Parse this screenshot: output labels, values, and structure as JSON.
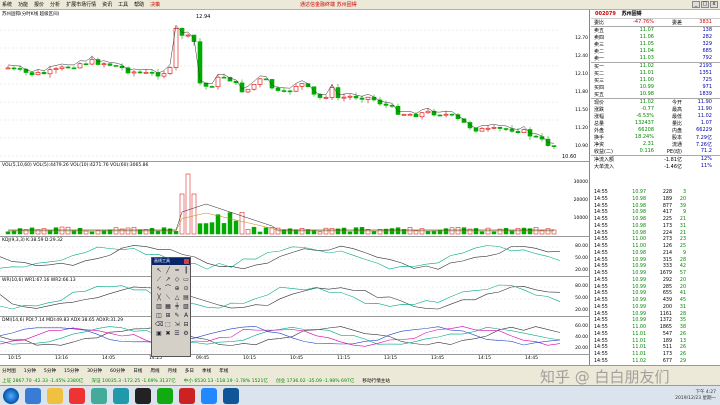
{
  "menu": {
    "items": [
      "系统",
      "功能",
      "报价",
      "分析",
      "扩展市场行情",
      "资讯",
      "工具",
      "帮助"
    ],
    "highlight": "决策",
    "center_title": "通达信金融终端 苏州固锝",
    "win_buttons": [
      "_",
      "□",
      "x"
    ]
  },
  "chart": {
    "price_header": "苏州固锝(分时K线 超级区间)",
    "high_label": "12.94",
    "low_label": "10.60",
    "price_axis": [
      "12.70",
      "12.40",
      "12.10",
      "11.80",
      "11.50",
      "11.20",
      "10.90"
    ],
    "volume_header": "VOL(5,10,60)  VOL(5):4479.26  VOL(10):4271.76  VOL(60):3065.86",
    "volume_axis": [
      "30000",
      "20000",
      "10000"
    ],
    "kdj_header": "KDJ(9,3,3)  K:38.59  D:29.32",
    "kdj_axis": [
      "80.00",
      "50.00",
      "20.00"
    ],
    "wr_header": "WR(10,6)  WR1:67.16  WR2:66.13",
    "wr_axis": [
      "80.00",
      "50.00",
      "20.00"
    ],
    "dmi_header": "DMI(14,6)  PDI:7.14  MDI:49.83  ADX:38.65  ADXR:31.29",
    "dmi_axis": [
      "60.00",
      "40.00",
      "20.00"
    ],
    "time_labels": [
      "10:15",
      "13:16",
      "14:05",
      "14:25",
      "09:45",
      "10:15",
      "10:45",
      "11:15",
      "13:15",
      "13:45",
      "14:15",
      "14:45"
    ]
  },
  "toolbox": {
    "title": "画线工具",
    "tools": [
      "↖",
      "╱",
      "━",
      "┃",
      "⟋",
      "↗",
      "◇",
      "▭",
      "∿",
      "⌒",
      "⊕",
      "⊙",
      "╳",
      "⟍",
      "△",
      "▤",
      "▥",
      "▦",
      "╪",
      "▧",
      "◫",
      "⊞",
      "✎",
      "A",
      "⌫",
      "⬚",
      "⇲",
      "⊟",
      "▣",
      "✖",
      "☰",
      "⚙"
    ]
  },
  "quote": {
    "code": "002079",
    "name": "苏州固锝",
    "header_rows": [
      {
        "a": "委比",
        "b": "-47.76%",
        "c": "委差",
        "d": "3831"
      }
    ],
    "sell_rows": [
      {
        "a": "卖五",
        "b": "11.07",
        "d": "138"
      },
      {
        "a": "卖四",
        "b": "11.06",
        "d": "282"
      },
      {
        "a": "卖三",
        "b": "11.05",
        "d": "329"
      },
      {
        "a": "卖二",
        "b": "11.04",
        "d": "685"
      },
      {
        "a": "卖一",
        "b": "11.03",
        "d": "792"
      }
    ],
    "buy_rows": [
      {
        "a": "买一",
        "b": "11.02",
        "d": "2193"
      },
      {
        "a": "买二",
        "b": "11.01",
        "d": "1351"
      },
      {
        "a": "买三",
        "b": "11.00",
        "d": "725"
      },
      {
        "a": "买四",
        "b": "10.99",
        "d": "971"
      },
      {
        "a": "买五",
        "b": "10.98",
        "d": "1839"
      }
    ],
    "stats_rows": [
      {
        "a": "现价",
        "b": "11.02",
        "c": "今开",
        "d": "11.90"
      },
      {
        "a": "涨跌",
        "b": "-0.77",
        "c": "最高",
        "d": "11.90"
      },
      {
        "a": "涨幅",
        "b": "-6.53%",
        "c": "最低",
        "d": "11.02"
      },
      {
        "a": "总量",
        "b": "132437",
        "c": "量比",
        "d": "1.07"
      },
      {
        "a": "外盘",
        "b": "66208",
        "c": "内盘",
        "d": "66229"
      },
      {
        "a": "换手",
        "b": "18.24%",
        "c": "股本",
        "d": "7.29亿"
      },
      {
        "a": "净资",
        "b": "2.31",
        "c": "流通",
        "d": "7.26亿"
      },
      {
        "a": "收益(二)",
        "b": "0.116",
        "c": "PE(动)",
        "d": "71.2"
      }
    ],
    "flow_rows": [
      {
        "a": "净流入额",
        "b": "",
        "c": "-1.81亿",
        "d": "12%"
      },
      {
        "a": "大单流入",
        "b": "",
        "c": "-1.46亿",
        "d": "11%"
      }
    ]
  },
  "ticks": [
    {
      "t": "14:55",
      "p": "10.97",
      "v": "228",
      "n": "3"
    },
    {
      "t": "14:55",
      "p": "10.98",
      "v": "189",
      "n": "20"
    },
    {
      "t": "14:55",
      "p": "10.98",
      "v": "877",
      "n": "39"
    },
    {
      "t": "14:55",
      "p": "10.98",
      "v": "417",
      "n": "9"
    },
    {
      "t": "14:55",
      "p": "10.98",
      "v": "225",
      "n": "21"
    },
    {
      "t": "14:55",
      "p": "10.98",
      "v": "173",
      "n": "31"
    },
    {
      "t": "14:55",
      "p": "10.98",
      "v": "224",
      "n": "21"
    },
    {
      "t": "14:55",
      "p": "11.00",
      "v": "273",
      "n": "23"
    },
    {
      "t": "14:55",
      "p": "11.00",
      "v": "126",
      "n": "25"
    },
    {
      "t": "14:55",
      "p": "10.98",
      "v": "214",
      "n": "9"
    },
    {
      "t": "14:55",
      "p": "10.99",
      "v": "315",
      "n": "28"
    },
    {
      "t": "14:55",
      "p": "10.99",
      "v": "333",
      "n": "42"
    },
    {
      "t": "14:55",
      "p": "10.99",
      "v": "1679",
      "n": "57"
    },
    {
      "t": "14:55",
      "p": "10.99",
      "v": "292",
      "n": "20"
    },
    {
      "t": "14:55",
      "p": "10.99",
      "v": "285",
      "n": "20"
    },
    {
      "t": "14:55",
      "p": "10.99",
      "v": "655",
      "n": "41"
    },
    {
      "t": "14:55",
      "p": "10.99",
      "v": "439",
      "n": "45"
    },
    {
      "t": "14:55",
      "p": "10.99",
      "v": "200",
      "n": "31"
    },
    {
      "t": "14:55",
      "p": "10.99",
      "v": "1161",
      "n": "28"
    },
    {
      "t": "14:55",
      "p": "10.99",
      "v": "1372",
      "n": "35"
    },
    {
      "t": "14:55",
      "p": "11.00",
      "v": "1865",
      "n": "38"
    },
    {
      "t": "14:55",
      "p": "11.01",
      "v": "547",
      "n": "26"
    },
    {
      "t": "14:55",
      "p": "11.01",
      "v": "189",
      "n": "13"
    },
    {
      "t": "14:55",
      "p": "11.01",
      "v": "511",
      "n": "26"
    },
    {
      "t": "14:55",
      "p": "11.01",
      "v": "173",
      "n": "26"
    },
    {
      "t": "14:55",
      "p": "11.02",
      "v": "677",
      "n": "29"
    },
    {
      "t": "14:55",
      "p": "11.02",
      "v": "212",
      "n": "33"
    },
    {
      "t": "14:55",
      "p": "11.02",
      "v": "179",
      "n": "11"
    }
  ],
  "status": {
    "row1": [
      "分时图",
      "1分钟",
      "5分钟",
      "15分钟",
      "30分钟",
      "60分钟",
      "日线",
      "周线",
      "月线",
      "多日",
      "季线",
      "年线"
    ],
    "row2": [
      "上证 2867.70 -42.33 -1.45% 2380亿",
      "深证 10035.3 -172.25 -1.69% 3137亿",
      "中小 6530.13 -118.19 -1.78% 1521亿",
      "创业 1736.02 -35.09 -1.98% 697亿",
      "移动行情主站"
    ]
  },
  "taskbar": {
    "clock_time": "下午 4:27",
    "clock_date": "2019/12/23 星期一"
  },
  "watermark": "知乎 @ 白白朋友们"
}
